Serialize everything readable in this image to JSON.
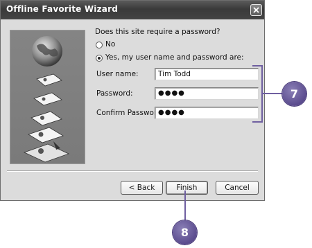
{
  "window": {
    "title": "Offline Favorite Wizard"
  },
  "question": "Does this site require a password?",
  "options": [
    {
      "label": "No",
      "selected": false
    },
    {
      "label": "Yes, my user name and password are:",
      "selected": true
    }
  ],
  "fields": {
    "username": {
      "label": "User name:",
      "value": "Tim Todd"
    },
    "password": {
      "label": "Password:",
      "value": "●●●●"
    },
    "confirm": {
      "label": "Confirm Password:",
      "value": "●●●●"
    }
  },
  "buttons": {
    "back": "< Back",
    "finish": "Finish",
    "cancel": "Cancel"
  },
  "callouts": {
    "fields_step": "7",
    "finish_step": "8"
  },
  "colors": {
    "callout": "#5b4c8e",
    "title_bar": "#3f3f3f",
    "dialog_bg": "#dcdcdc"
  }
}
